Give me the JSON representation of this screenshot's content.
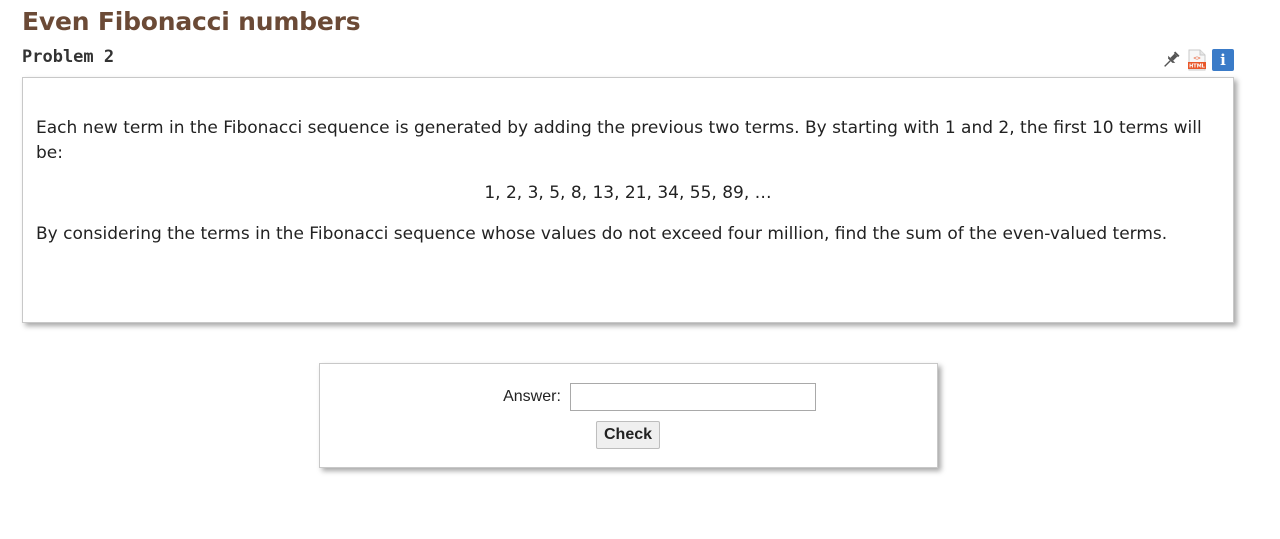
{
  "page": {
    "title": "Even Fibonacci numbers",
    "problem_id": "Problem 2"
  },
  "toolbar": {
    "icons": [
      "pin-icon",
      "html-icon",
      "info-icon"
    ],
    "info_glyph": "i",
    "html_glyph": "HTML"
  },
  "problem": {
    "paragraph_1": "Each new term in the Fibonacci sequence is generated by adding the previous two terms. By starting with 1 and 2, the first 10 terms will be:",
    "sequence": "1, 2, 3, 5, 8, 13, 21, 34, 55, 89, …",
    "paragraph_2": "By considering the terms in the Fibonacci sequence whose values do not exceed four million, find the sum of the even-valued terms."
  },
  "answer_form": {
    "label": "Answer:",
    "input_value": "",
    "button_label": "Check"
  },
  "colors": {
    "title": "#6b4a36",
    "info_icon_bg": "#3a7bc8",
    "html_icon_accent": "#e8572a"
  }
}
